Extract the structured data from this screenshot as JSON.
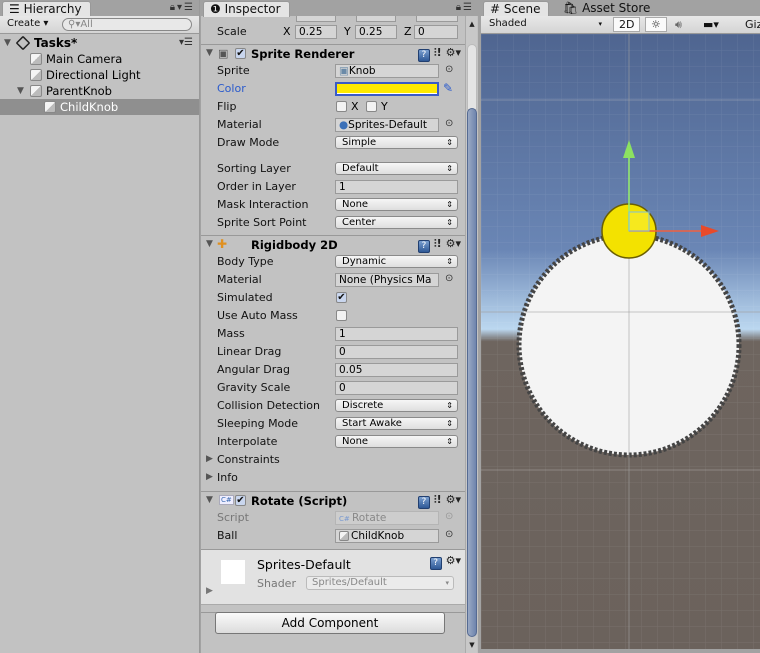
{
  "hierarchy": {
    "tab_label": "Hierarchy",
    "create_label": "Create",
    "search_placeholder": "All",
    "scene_name": "Tasks*",
    "items": [
      {
        "label": "Main Camera",
        "depth": 1,
        "selected": false
      },
      {
        "label": "Directional Light",
        "depth": 1,
        "selected": false
      },
      {
        "label": "ParentKnob",
        "depth": 1,
        "selected": false,
        "expanded": true
      },
      {
        "label": "ChildKnob",
        "depth": 2,
        "selected": true
      }
    ]
  },
  "inspector": {
    "tab_label": "Inspector",
    "transform": {
      "scale_label": "Scale",
      "x_label": "X",
      "x": "0.25",
      "y_label": "Y",
      "y": "0.25",
      "z_label": "Z",
      "z": "0"
    },
    "sprite_renderer": {
      "title": "Sprite Renderer",
      "enabled": true,
      "sprite_label": "Sprite",
      "sprite": "Knob",
      "color_label": "Color",
      "color": "#ffea00",
      "flip_label": "Flip",
      "flip_x_label": "X",
      "flip_y_label": "Y",
      "flip_x": false,
      "flip_y": false,
      "material_label": "Material",
      "material": "Sprites-Default",
      "draw_mode_label": "Draw Mode",
      "draw_mode": "Simple",
      "sorting_layer_label": "Sorting Layer",
      "sorting_layer": "Default",
      "order_label": "Order in Layer",
      "order": "1",
      "mask_label": "Mask Interaction",
      "mask": "None",
      "sort_point_label": "Sprite Sort Point",
      "sort_point": "Center"
    },
    "rigidbody": {
      "title": "Rigidbody 2D",
      "body_type_label": "Body Type",
      "body_type": "Dynamic",
      "material_label": "Material",
      "material": "None (Physics Ma",
      "simulated_label": "Simulated",
      "simulated": true,
      "auto_mass_label": "Use Auto Mass",
      "auto_mass": false,
      "mass_label": "Mass",
      "mass": "1",
      "linear_drag_label": "Linear Drag",
      "linear_drag": "0",
      "angular_drag_label": "Angular Drag",
      "angular_drag": "0.05",
      "gravity_label": "Gravity Scale",
      "gravity": "0",
      "collision_label": "Collision Detection",
      "collision": "Discrete",
      "sleeping_label": "Sleeping Mode",
      "sleeping": "Start Awake",
      "interpolate_label": "Interpolate",
      "interpolate": "None",
      "constraints_label": "Constraints",
      "info_label": "Info"
    },
    "rotate_script": {
      "title": "Rotate (Script)",
      "enabled": true,
      "script_label": "Script",
      "script": "Rotate",
      "ball_label": "Ball",
      "ball": "ChildKnob"
    },
    "material_preview": {
      "name": "Sprites-Default",
      "shader_label": "Shader",
      "shader": "Sprites/Default"
    },
    "add_component_label": "Add Component"
  },
  "scene": {
    "tabs": [
      "Scene",
      "Asset Store"
    ],
    "shading_mode": "Shaded",
    "mode_2d_label": "2D",
    "gizmos_label": "Giz"
  }
}
